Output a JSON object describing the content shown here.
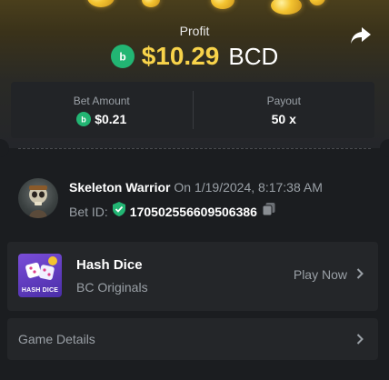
{
  "header": {
    "profit_label": "Profit",
    "profit_value": "$10.29",
    "currency": "BCD",
    "share_icon": "share-icon"
  },
  "stats": {
    "bet_amount_label": "Bet Amount",
    "bet_amount_value": "$0.21",
    "payout_label": "Payout",
    "payout_value": "50 x"
  },
  "user": {
    "name": "Skeleton Warrior",
    "timestamp": "On 1/19/2024, 8:17:38 AM",
    "bet_id_label": "Bet ID:",
    "bet_id_value": "170502556609506386"
  },
  "game": {
    "title": "Hash Dice",
    "subtitle": "BC Originals",
    "thumb_text": "HASH DICE",
    "play_label": "Play Now"
  },
  "details": {
    "label": "Game Details"
  },
  "colors": {
    "accent_gold": "#f8d34a",
    "bcd_green": "#22b573",
    "background": "#1b1d20",
    "card": "#242629"
  }
}
